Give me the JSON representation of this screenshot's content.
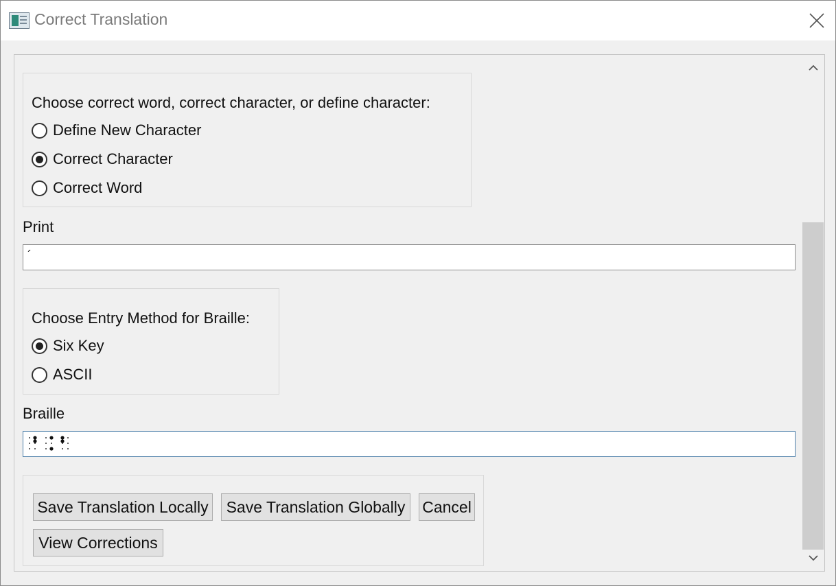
{
  "window": {
    "title": "Correct Translation",
    "icon": "app-icon",
    "close_icon": "close-icon"
  },
  "choice_group": {
    "prompt": "Choose correct word, correct character, or define character:",
    "options": [
      {
        "label": "Define New Character",
        "checked": false
      },
      {
        "label": "Correct Character",
        "checked": true
      },
      {
        "label": "Correct Word",
        "checked": false
      }
    ]
  },
  "print_field": {
    "label": "Print",
    "value": "´"
  },
  "entry_method_group": {
    "prompt": "Choose Entry Method for Braille:",
    "options": [
      {
        "label": "Six Key",
        "checked": true
      },
      {
        "label": "ASCII",
        "checked": false
      }
    ]
  },
  "braille_field": {
    "label": "Braille",
    "value": "⠨⠴⠨"
  },
  "buttons": {
    "save_local": "Save Translation Locally",
    "save_global": "Save Translation Globally",
    "cancel": "Cancel",
    "view_corrections": "View Corrections"
  },
  "scrollbar": {
    "up_icon": "chevron-up-icon",
    "down_icon": "chevron-down-icon"
  }
}
